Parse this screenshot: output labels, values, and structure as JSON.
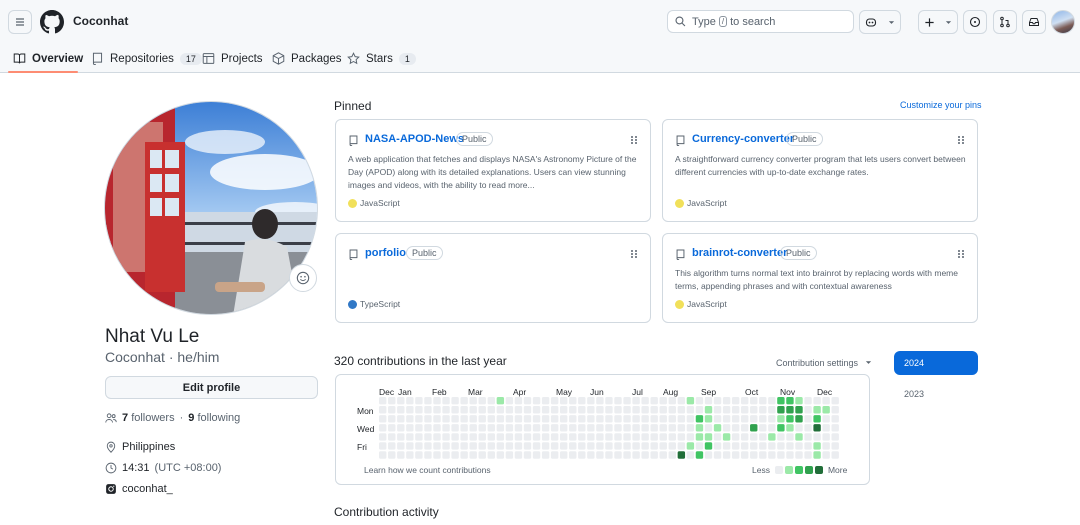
{
  "header": {
    "username": "Coconhat",
    "search_prefix": "Type",
    "search_key": "/",
    "search_suffix": "to search"
  },
  "tabs": [
    {
      "label": "Overview",
      "count": null,
      "icon": "book-icon",
      "active": true
    },
    {
      "label": "Repositories",
      "count": "17",
      "icon": "repo-icon",
      "active": false
    },
    {
      "label": "Projects",
      "count": null,
      "icon": "table-icon",
      "active": false
    },
    {
      "label": "Packages",
      "count": null,
      "icon": "package-icon",
      "active": false
    },
    {
      "label": "Stars",
      "count": "1",
      "icon": "star-icon",
      "active": false
    }
  ],
  "profile": {
    "full_name": "Nhat Vu Le",
    "handle": "Coconhat · he/him",
    "edit_label": "Edit profile",
    "followers_count": "7",
    "followers_label": "followers",
    "sep": "·",
    "following_count": "9",
    "following_label": "following",
    "location": "Philippines",
    "time": "14:31",
    "tz": "(UTC +08:00)",
    "social": "coconhat_"
  },
  "pinned": {
    "title": "Pinned",
    "customize": "Customize your pins",
    "cards": [
      {
        "name": "NASA-APOD-News",
        "visibility": "Public",
        "description": "A web application that fetches and displays NASA's Astronomy Picture of the Day (APOD) along with its detailed explanations. Users can view stunning images and videos, with the ability to read more...",
        "language": "JavaScript",
        "lang_color": "#f1e05a"
      },
      {
        "name": "Currency-converter",
        "visibility": "Public",
        "description": "A straightforward currency converter program that lets users convert between different currencies with up-to-date exchange rates.",
        "language": "JavaScript",
        "lang_color": "#f1e05a"
      },
      {
        "name": "porfolio",
        "visibility": "Public",
        "description": "",
        "language": "TypeScript",
        "lang_color": "#3178c6"
      },
      {
        "name": "brainrot-converter",
        "visibility": "Public",
        "description": "This algorithm turns normal text into brainrot by replacing words with meme terms, appending phrases and with contextual awareness",
        "language": "JavaScript",
        "lang_color": "#f1e05a"
      }
    ]
  },
  "contributions": {
    "title": "320 contributions in the last year",
    "settings": "Contribution settings",
    "months": [
      "Dec",
      "Jan",
      "Feb",
      "Mar",
      "Apr",
      "May",
      "Jun",
      "Jul",
      "Aug",
      "Sep",
      "Oct",
      "Nov",
      "Dec"
    ],
    "days": [
      "Mon",
      "Wed",
      "Fri"
    ],
    "learn": "Learn how we count contributions",
    "less": "Less",
    "more": "More",
    "level_colors": [
      "#ebedf0",
      "#9be9a8",
      "#40c463",
      "#30a14e",
      "#216e39"
    ],
    "grid": [
      [
        0,
        0,
        0,
        0,
        0,
        0,
        0,
        0,
        0,
        0,
        0,
        0,
        0,
        1,
        0,
        0,
        0,
        0,
        0,
        0,
        0,
        0,
        0,
        0,
        0,
        0,
        0,
        0,
        0,
        0,
        0,
        0,
        0,
        0,
        1,
        0,
        0,
        0,
        0,
        0,
        0,
        0,
        0,
        0,
        2,
        2,
        1,
        0,
        0,
        0,
        0
      ],
      [
        0,
        0,
        0,
        0,
        0,
        0,
        0,
        0,
        0,
        0,
        0,
        0,
        0,
        0,
        0,
        0,
        0,
        0,
        0,
        0,
        0,
        0,
        0,
        0,
        0,
        0,
        0,
        0,
        0,
        0,
        0,
        0,
        0,
        0,
        0,
        0,
        1,
        0,
        0,
        0,
        0,
        0,
        0,
        0,
        3,
        3,
        3,
        0,
        1,
        1,
        0
      ],
      [
        0,
        0,
        0,
        0,
        0,
        0,
        0,
        0,
        0,
        0,
        0,
        0,
        0,
        0,
        0,
        0,
        0,
        0,
        0,
        0,
        0,
        0,
        0,
        0,
        0,
        0,
        0,
        0,
        0,
        0,
        0,
        0,
        0,
        0,
        0,
        2,
        1,
        0,
        0,
        0,
        0,
        0,
        0,
        0,
        1,
        2,
        3,
        0,
        2,
        0,
        0
      ],
      [
        0,
        0,
        0,
        0,
        0,
        0,
        0,
        0,
        0,
        0,
        0,
        0,
        0,
        0,
        0,
        0,
        0,
        0,
        0,
        0,
        0,
        0,
        0,
        0,
        0,
        0,
        0,
        0,
        0,
        0,
        0,
        0,
        0,
        0,
        0,
        1,
        0,
        1,
        0,
        0,
        0,
        3,
        0,
        0,
        2,
        1,
        0,
        0,
        4,
        0,
        0
      ],
      [
        0,
        0,
        0,
        0,
        0,
        0,
        0,
        0,
        0,
        0,
        0,
        0,
        0,
        0,
        0,
        0,
        0,
        0,
        0,
        0,
        0,
        0,
        0,
        0,
        0,
        0,
        0,
        0,
        0,
        0,
        0,
        0,
        0,
        0,
        0,
        1,
        1,
        0,
        1,
        0,
        0,
        0,
        0,
        1,
        0,
        0,
        1,
        0,
        0,
        0,
        0
      ],
      [
        0,
        0,
        0,
        0,
        0,
        0,
        0,
        0,
        0,
        0,
        0,
        0,
        0,
        0,
        0,
        0,
        0,
        0,
        0,
        0,
        0,
        0,
        0,
        0,
        0,
        0,
        0,
        0,
        0,
        0,
        0,
        0,
        0,
        0,
        1,
        0,
        2,
        0,
        0,
        0,
        0,
        0,
        0,
        0,
        0,
        0,
        0,
        0,
        1,
        0,
        0
      ],
      [
        0,
        0,
        0,
        0,
        0,
        0,
        0,
        0,
        0,
        0,
        0,
        0,
        0,
        0,
        0,
        0,
        0,
        0,
        0,
        0,
        0,
        0,
        0,
        0,
        0,
        0,
        0,
        0,
        0,
        0,
        0,
        0,
        0,
        4,
        0,
        2,
        0,
        0,
        0,
        0,
        0,
        0,
        0,
        0,
        0,
        0,
        0,
        0,
        1,
        0,
        0
      ]
    ],
    "years": [
      "2024",
      "2023"
    ],
    "active_year": "2024"
  },
  "activity": {
    "title": "Contribution activity"
  }
}
